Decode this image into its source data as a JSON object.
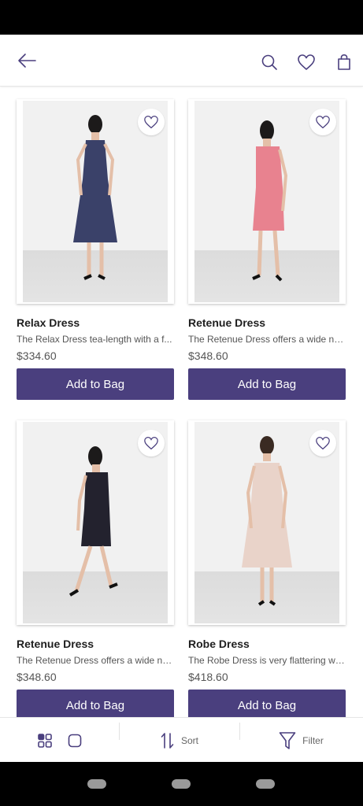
{
  "header": {
    "back_icon": "arrow-left-icon",
    "search_icon": "search-icon",
    "wishlist_icon": "heart-icon",
    "bag_icon": "shopping-bag-icon"
  },
  "products": [
    {
      "title": "Relax Dress",
      "description": "The Relax Dress tea-length with a f...",
      "price": "$334.60",
      "button_label": "Add to Bag",
      "dress_color": "#3a4169"
    },
    {
      "title": "Retenue Dress",
      "description": "The Retenue Dress offers a wide ne...",
      "price": "$348.60",
      "button_label": "Add to Bag",
      "dress_color": "#e8828f"
    },
    {
      "title": "Retenue Dress",
      "description": "The Retenue Dress offers a wide ne...",
      "price": "$348.60",
      "button_label": "Add to Bag",
      "dress_color": "#23222e"
    },
    {
      "title": "Robe Dress",
      "description": "The Robe Dress is very flattering wit...",
      "price": "$418.60",
      "button_label": "Add to Bag",
      "dress_color": "#e9d3c9"
    }
  ],
  "bottom_bar": {
    "sort_label": "Sort",
    "filter_label": "Filter"
  },
  "colors": {
    "accent": "#4a3f7e"
  }
}
